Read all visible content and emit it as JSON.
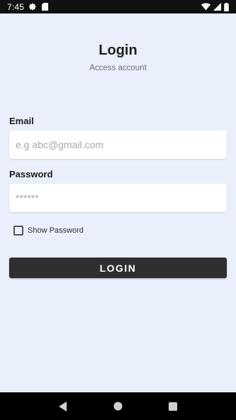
{
  "status_bar": {
    "time": "7:45",
    "icons_left": [
      "gear-icon",
      "sd-card-icon"
    ],
    "icons_right": [
      "wifi-icon",
      "signal-icon",
      "battery-icon"
    ]
  },
  "header": {
    "title": "Login",
    "subtitle": "Access account"
  },
  "form": {
    "email_label": "Email",
    "email_placeholder": "e.g abc@gmail.com",
    "email_value": "",
    "password_label": "Password",
    "password_placeholder": "******",
    "password_value": "",
    "show_password_label": "Show Password",
    "show_password_checked": false,
    "login_button_label": "LOGIN"
  },
  "nav_bar": {
    "buttons": [
      "back-icon",
      "home-icon",
      "recents-icon"
    ]
  },
  "colors": {
    "background": "#e9f0fb",
    "button": "#2f2f2f",
    "status_bar": "#111111",
    "nav_bar": "#000000"
  }
}
